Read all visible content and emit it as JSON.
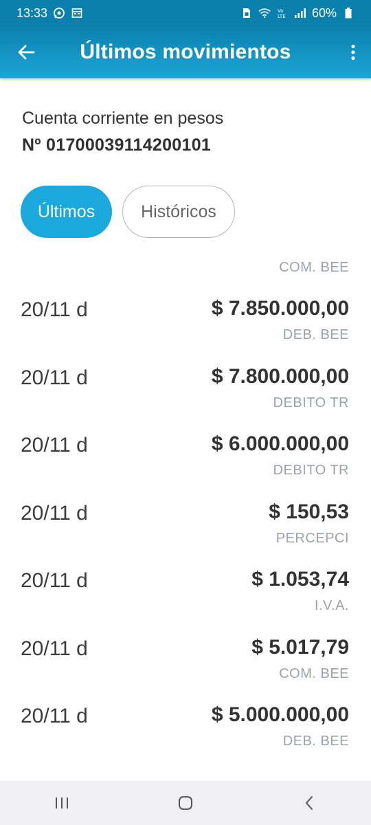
{
  "status_bar": {
    "time": "13:33",
    "battery": "60%",
    "icons": [
      "whatsapp-icon",
      "calendar-icon",
      "sim-icon",
      "wifi-icon",
      "volte-icon",
      "signal-icon",
      "battery-icon"
    ]
  },
  "app_bar": {
    "title": "Últimos movimientos",
    "back_icon": "arrow-left-icon",
    "menu_icon": "more-vert-icon"
  },
  "account": {
    "type": "Cuenta corriente en pesos",
    "number": "Nº 01700039114200101"
  },
  "tabs": [
    {
      "label": "Últimos",
      "active": true
    },
    {
      "label": "Históricos",
      "active": false
    }
  ],
  "movements": {
    "top_partial_desc": "COM. BEE",
    "items": [
      {
        "date": "20/11 d",
        "amount": "$ 7.850.000,00",
        "desc": "DEB. BEE"
      },
      {
        "date": "20/11 d",
        "amount": "$ 7.800.000,00",
        "desc": "DEBITO TR"
      },
      {
        "date": "20/11 d",
        "amount": "$ 6.000.000,00",
        "desc": "DEBITO TR"
      },
      {
        "date": "20/11 d",
        "amount": "$ 150,53",
        "desc": "PERCEPCI"
      },
      {
        "date": "20/11 d",
        "amount": "$ 1.053,74",
        "desc": "I.V.A."
      },
      {
        "date": "20/11 d",
        "amount": "$ 5.017,79",
        "desc": "COM. BEE"
      },
      {
        "date": "20/11 d",
        "amount": "$ 5.000.000,00",
        "desc": "DEB. BEE"
      }
    ]
  },
  "nav_bar": {
    "icons": [
      "recent-apps-icon",
      "home-icon",
      "back-icon"
    ]
  },
  "colors": {
    "primary": "#0c80ad",
    "accent": "#1ba9dd",
    "text": "#333333",
    "muted": "#9aa3a9"
  }
}
